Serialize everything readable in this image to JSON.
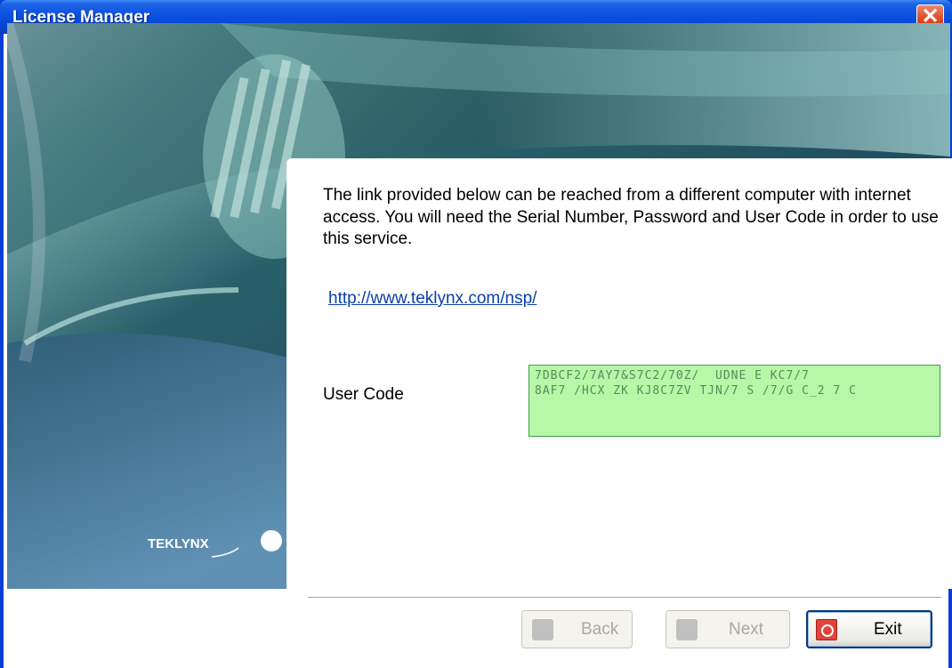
{
  "window": {
    "title": "License Manager",
    "close_glyph": "✕"
  },
  "content": {
    "description": "The link provided below can be reached from a different computer with internet access. You will need the Serial Number, Password and User Code in order to use this service.",
    "link": "http://www.teklynx.com/nsp/",
    "user_code_label": "User Code",
    "user_code_value": "7DBCF2/7AY7&S7C2/70Z/  UDNE E KC7/7\n8AF7 /HCX ZK KJ8C7ZV TJN/7 S /7/G C_2 7 C"
  },
  "brand": {
    "logo_text": "TEKLYNX"
  },
  "buttons": {
    "back": "Back",
    "next": "Next",
    "exit": "Exit"
  },
  "colors": {
    "titlebar": "#0b50e0",
    "user_code_bg": "#b6f7a8",
    "link": "#0a3fa8"
  },
  "icons": {
    "close": "close-icon",
    "back": "back-icon",
    "next": "next-icon",
    "exit": "exit-icon"
  }
}
